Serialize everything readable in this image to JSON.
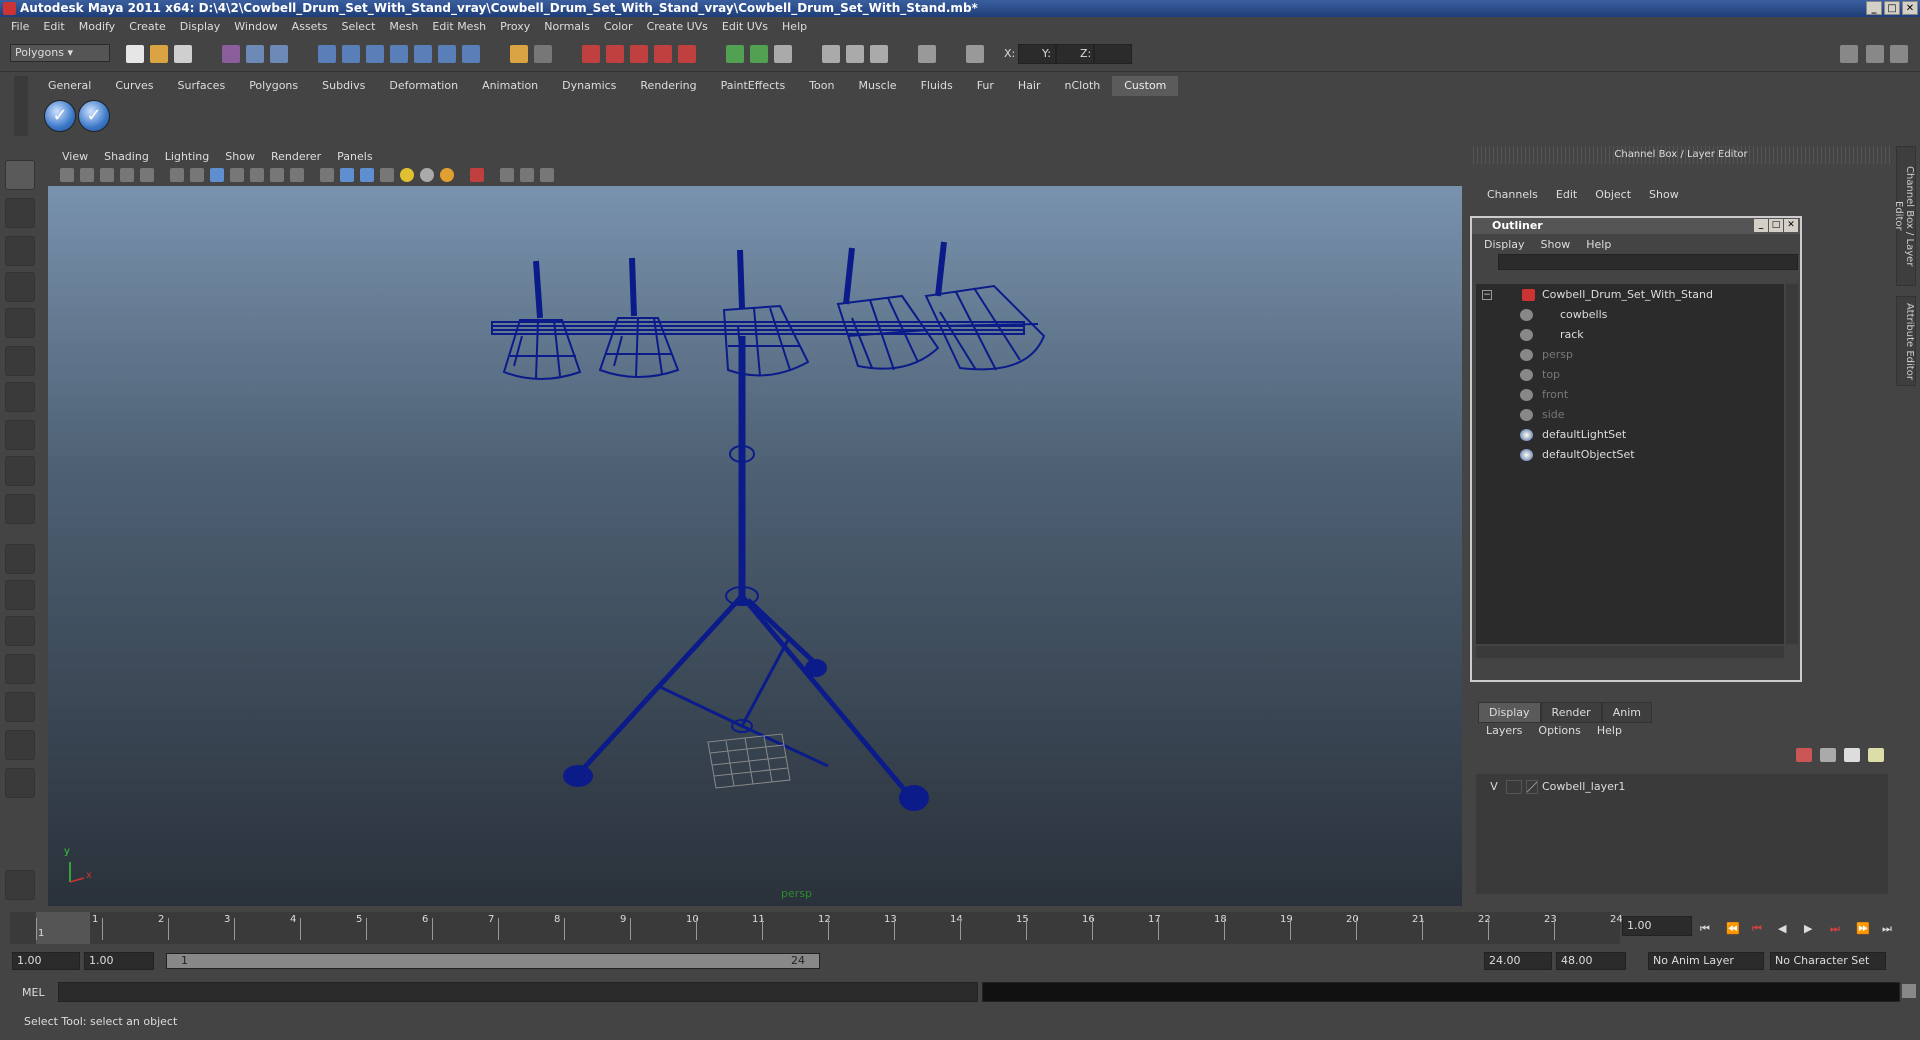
{
  "window": {
    "title": "Autodesk Maya 2011 x64: D:\\4\\2\\Cowbell_Drum_Set_With_Stand_vray\\Cowbell_Drum_Set_With_Stand_vray\\Cowbell_Drum_Set_With_Stand.mb*",
    "min": "_",
    "max": "□",
    "close": "✕"
  },
  "menubar": [
    "File",
    "Edit",
    "Modify",
    "Create",
    "Display",
    "Window",
    "Assets",
    "Select",
    "Mesh",
    "Edit Mesh",
    "Proxy",
    "Normals",
    "Color",
    "Create UVs",
    "Edit UVs",
    "Help"
  ],
  "statusline": {
    "mode": "Polygons",
    "x_label": "X:",
    "y_label": "Y:",
    "z_label": "Z:"
  },
  "shelf": {
    "tabs": [
      "General",
      "Curves",
      "Surfaces",
      "Polygons",
      "Subdivs",
      "Deformation",
      "Animation",
      "Dynamics",
      "Rendering",
      "PaintEffects",
      "Toon",
      "Muscle",
      "Fluids",
      "Fur",
      "Hair",
      "nCloth",
      "Custom"
    ],
    "active": "Custom",
    "buttons": [
      "✓",
      "✓"
    ]
  },
  "viewport": {
    "menu": [
      "View",
      "Shading",
      "Lighting",
      "Show",
      "Renderer",
      "Panels"
    ],
    "camera_label": "persp",
    "axis_x": "x",
    "axis_y": "y"
  },
  "channelbox": {
    "header": "Channel Box / Layer Editor",
    "menu": [
      "Channels",
      "Edit",
      "Object",
      "Show"
    ]
  },
  "outliner": {
    "title": "Outliner",
    "menu": [
      "Display",
      "Show",
      "Help"
    ],
    "items": [
      {
        "label": "Cowbell_Drum_Set_With_Stand",
        "dim": false
      },
      {
        "label": "cowbells",
        "dim": false
      },
      {
        "label": "rack",
        "dim": false
      },
      {
        "label": "persp",
        "dim": true
      },
      {
        "label": "top",
        "dim": true
      },
      {
        "label": "front",
        "dim": true
      },
      {
        "label": "side",
        "dim": true
      },
      {
        "label": "defaultLightSet",
        "dim": false
      },
      {
        "label": "defaultObjectSet",
        "dim": false
      }
    ]
  },
  "layers": {
    "tabs": [
      "Display",
      "Render",
      "Anim"
    ],
    "active": "Display",
    "menu": [
      "Layers",
      "Options",
      "Help"
    ],
    "row": {
      "visible": "V",
      "name": "Cowbell_layer1"
    }
  },
  "sidetabs": [
    "Channel Box / Layer Editor",
    "Attribute Editor"
  ],
  "timeline": {
    "ticks": [
      "1",
      "2",
      "3",
      "4",
      "5",
      "6",
      "7",
      "8",
      "9",
      "10",
      "11",
      "12",
      "13",
      "14",
      "15",
      "16",
      "17",
      "18",
      "19",
      "20",
      "21",
      "22",
      "23",
      "24"
    ],
    "current_marker": "1",
    "current_frame": "1.00"
  },
  "range": {
    "start": "1.00",
    "playback_start": "1.00",
    "slider_start": "1",
    "slider_end": "24",
    "playback_end": "24.00",
    "end": "48.00",
    "anim_layer": "No Anim Layer",
    "char_set": "No Character Set"
  },
  "command": {
    "label": "MEL"
  },
  "status": {
    "text": "Select Tool: select an object"
  },
  "colors": {
    "wire": "#0b1c8a",
    "bg_top": "#7992ad",
    "bg_bottom": "#2a313a"
  }
}
